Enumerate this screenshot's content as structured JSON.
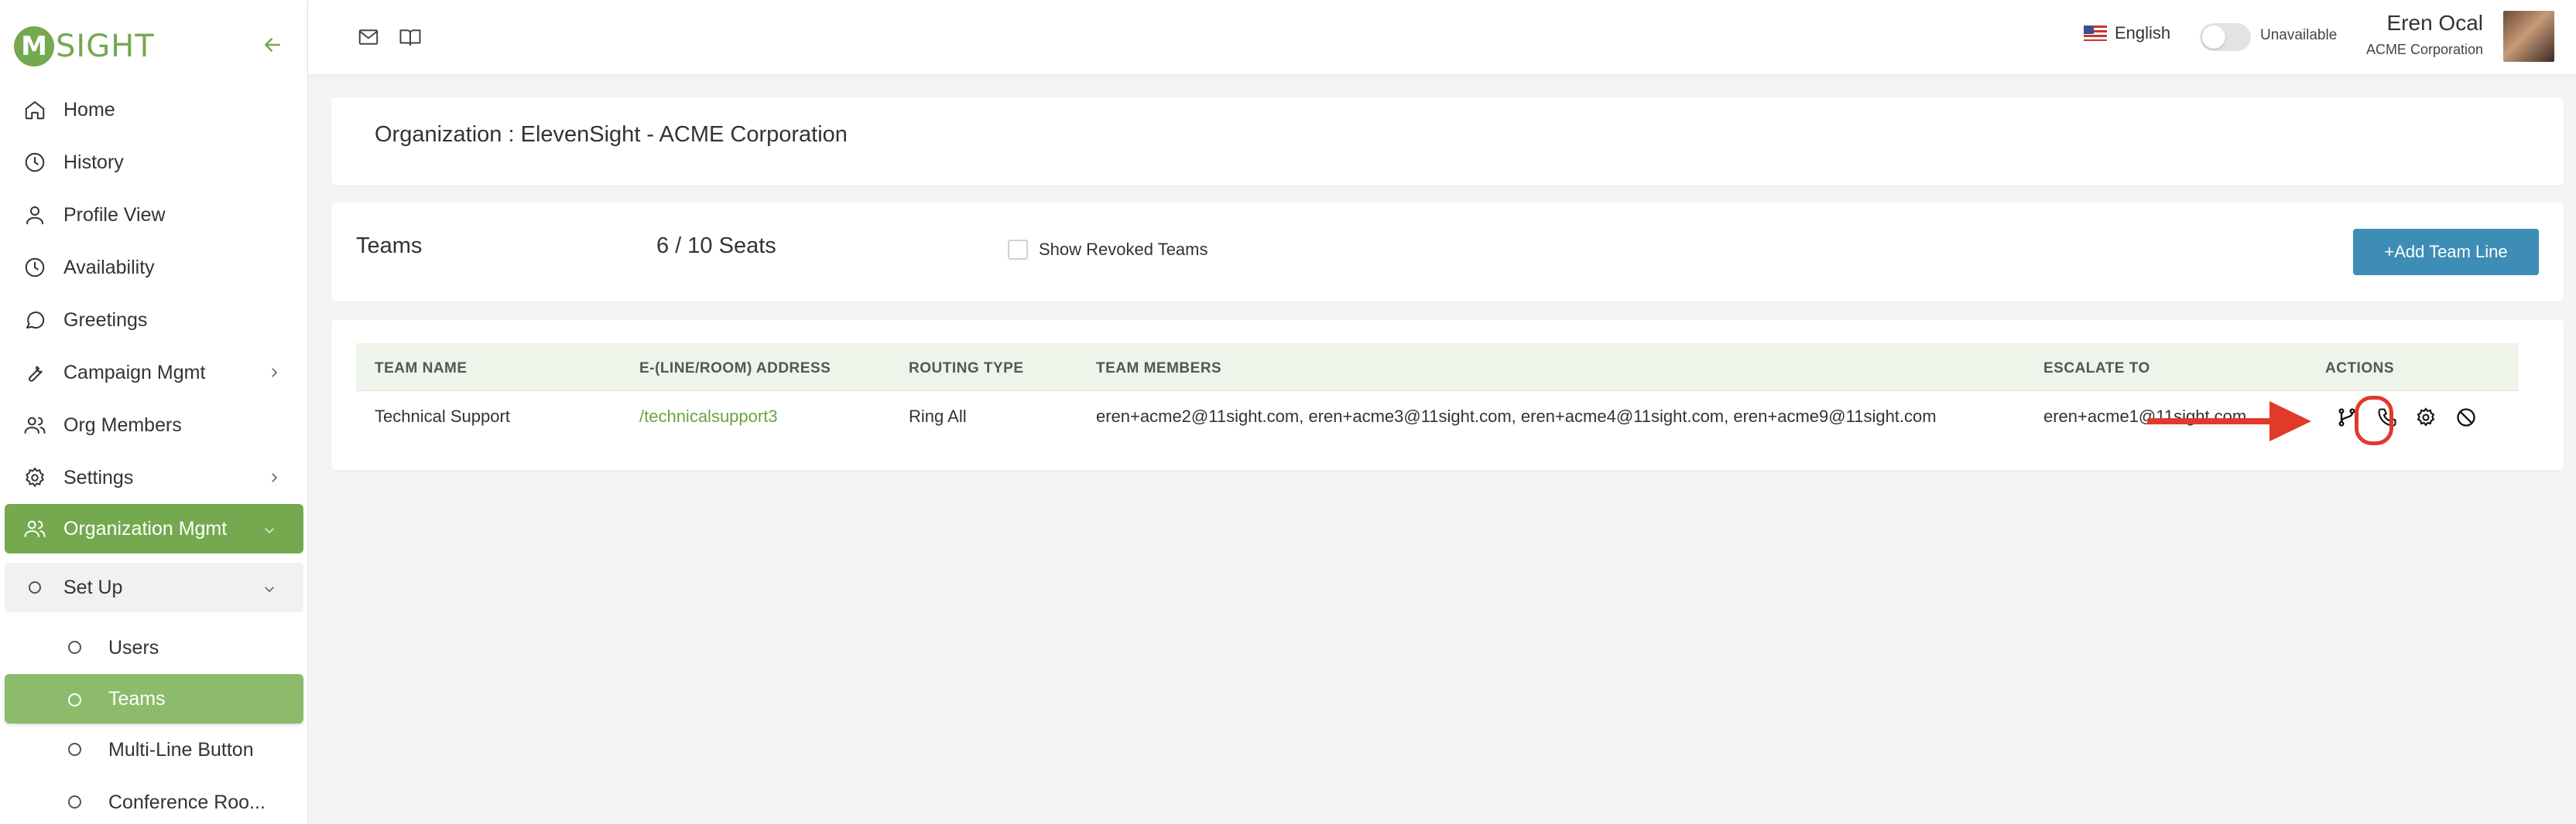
{
  "brand": {
    "logo_mark": "M",
    "logo_text": "SIGHT"
  },
  "sidebar": {
    "items": [
      {
        "label": "Home"
      },
      {
        "label": "History"
      },
      {
        "label": "Profile View"
      },
      {
        "label": "Availability"
      },
      {
        "label": "Greetings"
      },
      {
        "label": "Campaign Mgmt"
      },
      {
        "label": "Org Members"
      },
      {
        "label": "Settings"
      },
      {
        "label": "Organization Mgmt"
      },
      {
        "label": "Set Up"
      }
    ],
    "subitems": [
      {
        "label": "Users"
      },
      {
        "label": "Teams"
      },
      {
        "label": "Multi-Line Button"
      },
      {
        "label": "Conference Roo..."
      }
    ]
  },
  "topbar": {
    "language": "English",
    "availability_status": "Unavailable",
    "availability_on": false,
    "user_name": "Eren Ocal",
    "user_org": "ACME Corporation"
  },
  "org": {
    "title": "Organization : ElevenSight - ACME Corporation"
  },
  "teams": {
    "title": "Teams",
    "seats": "6 / 10 Seats",
    "show_revoked_label": "Show Revoked Teams",
    "show_revoked_checked": false,
    "add_button": "+Add Team Line"
  },
  "table": {
    "columns": [
      "TEAM NAME",
      "E-(LINE/ROOM) ADDRESS",
      "ROUTING TYPE",
      "TEAM MEMBERS",
      "ESCALATE TO",
      "ACTIONS"
    ],
    "rows": [
      {
        "team_name": "Technical Support",
        "address": "/technicalsupport3",
        "routing_type": "Ring All",
        "members": "eren+acme2@11sight.com, eren+acme3@11sight.com, eren+acme4@11sight.com, eren+acme9@11sight.com",
        "escalate_to": "eren+acme1@11sight.com",
        "actions": [
          "routing-icon",
          "phone-icon",
          "gear-icon",
          "ban-icon"
        ]
      }
    ]
  },
  "colors": {
    "brand_green": "#74a94f",
    "button_blue": "#3d8db6",
    "highlight_red": "#e03a2b",
    "link_green": "#6aa441"
  }
}
